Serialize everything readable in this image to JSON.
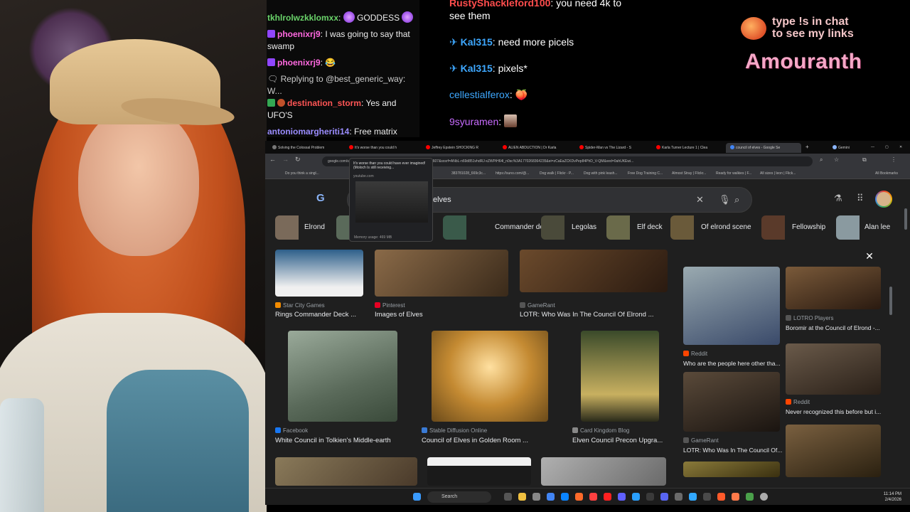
{
  "chat": {
    "messages": [
      {
        "user": "tkhlrolwzkklomxx",
        "user_color": "#6ad36a",
        "text": "GODDESS"
      },
      {
        "user": "phoenixrj9",
        "user_color": "#ff69e0",
        "text": "I was going to say that swamp"
      },
      {
        "user": "phoenixrj9",
        "user_color": "#ff69e0",
        "text": "😂"
      },
      {
        "reply_prefix": "Replying to @best_generic_way: W..."
      },
      {
        "user": "destination_storm",
        "user_color": "#ff5555",
        "text": "Yes and UFO'S"
      },
      {
        "user": "antoniomargheriti14",
        "user_color": "#9a8cff",
        "text": "Free matrix"
      }
    ]
  },
  "chat_right": {
    "messages": [
      {
        "user": "RustyShackleford100",
        "user_color": "#ff4d4d",
        "text": "you need 4k to"
      },
      {
        "user": "",
        "text": "see them"
      },
      {
        "user": "Kal315",
        "user_color": "#3ea8ff",
        "text": "need more picels"
      },
      {
        "user": "Kal315",
        "user_color": "#3ea8ff",
        "text": "pixels*"
      },
      {
        "user": "cellestialferox",
        "user_color": "#3ea8ff",
        "text": "🍑"
      },
      {
        "user": "9syuramen",
        "user_color": "#c86bff",
        "text": ""
      }
    ]
  },
  "overlay": {
    "cta_line1": "type !s in chat",
    "cta_line2": "to see my links",
    "brand": "Amouranth"
  },
  "browser": {
    "tabs": [
      {
        "label": "Solving the Colossal Problem",
        "fav": "#777"
      },
      {
        "label": "It's worse than you could h",
        "fav": "#ff0000"
      },
      {
        "label": "Jeffrey Epstein SHOCKING R",
        "fav": "#ff0000"
      },
      {
        "label": "ALIEN ABDUCTION | Dr Karla",
        "fav": "#ff0000"
      },
      {
        "label": "Spider-Man vs The Lizard - S",
        "fav": "#ff0000"
      },
      {
        "label": "Karla Turner Lecture 1 | Clea",
        "fav": "#ff0000"
      },
      {
        "label": "council of elves - Google Se",
        "fav": "#4285f4"
      },
      {
        "label": "+",
        "fav": ""
      },
      {
        "label": "Gemini",
        "fav": "#8ab4f8"
      }
    ],
    "url": "google.com/search?...a9ef4cc7a40688968udm=2&biw=1280&bih=607&sxsrf=ANbL-n69d851vhdRJ-xZWPiH64l_n0sc%3A1770268364235&ei=zCaEaZCKDvPep84PhD_V-QM&ved=0ahUKEwi...",
    "bookmarks": [
      "Do you think a singl...",
      "383781028_669c3c...",
      "https://suno.com/@...",
      "Dog walk | Flickr - P...",
      "Dog with pink leash...",
      "Free Dog Training C...",
      "Almost Stray | Flickr...",
      "Ready for walkies | F...",
      "All sizes | leon | Flick...",
      "All Bookmarks"
    ],
    "tooltip": {
      "title": "It's worse than you could have ever imagined! (Moloch Is still receiving...",
      "domain": "youtube.com",
      "memory": "Memory usage: 469 MB"
    }
  },
  "google": {
    "logo": "G",
    "query": "elves",
    "chips": [
      "Elrond",
      "",
      "Commander deck",
      "Legolas",
      "Elf deck",
      "Of elrond scene",
      "Fellowship",
      "Alan lee"
    ],
    "results": [
      {
        "source": "Star City Games",
        "title": "Rings Commander Deck ...",
        "color": "#2d5f8a",
        "icon": "#f28b00"
      },
      {
        "source": "Pinterest",
        "title": "Images of Elves",
        "color": "#8a6a48",
        "icon": "#e60023"
      },
      {
        "source": "GameRant",
        "title": "LOTR: Who Was In The Council Of Elrond ...",
        "color": "#6b4a2c",
        "icon": "#555"
      },
      {
        "source": "Facebook",
        "title": "White Council in Tolkien's Middle-earth",
        "color": "#7a8a7a",
        "icon": "#1877f2"
      },
      {
        "source": "Stable Diffusion Online",
        "title": "Council of Elves in Golden Room ...",
        "color": "#c48a32",
        "icon": "#3a7bd5"
      },
      {
        "source": "Card Kingdom Blog",
        "title": "Elven Council Precon Upgra...",
        "color": "#3a4a2a",
        "icon": "#888"
      },
      {
        "source": "",
        "title": "",
        "color": "#8a7a5a",
        "icon": ""
      },
      {
        "source": "",
        "title": "",
        "color": "#1a1a1a",
        "icon": ""
      },
      {
        "source": "",
        "title": "",
        "color": "#9a9a9a",
        "icon": ""
      }
    ],
    "side": [
      {
        "source": "Reddit",
        "title": "Who are the people here other tha...",
        "color": "#6a7a8a",
        "icon": "#ff4500"
      },
      {
        "source": "LOTRO Players",
        "title": "Boromir at the Council of Elrond -...",
        "color": "#7a5a3a",
        "icon": "#555"
      },
      {
        "source": "GameRant",
        "title": "LOTR: Who Was In The Council Of...",
        "color": "#5a4a3a",
        "icon": "#555"
      },
      {
        "source": "Reddit",
        "title": "Never recognized this before but i...",
        "color": "#5a4030",
        "icon": "#ff4500"
      }
    ]
  },
  "taskbar": {
    "search": "Search",
    "time": "11:14 PM",
    "date": "2/4/2026"
  }
}
